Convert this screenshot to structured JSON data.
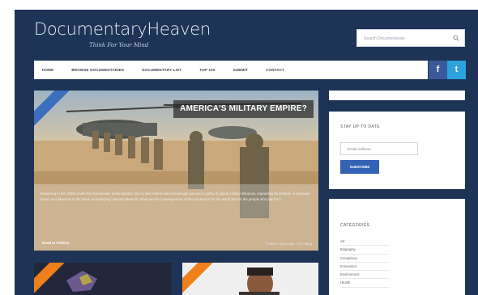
{
  "site": {
    "logo": "DocumentaryHeaven",
    "tagline": "Think For Your Mind",
    "search_placeholder": "Search Documentaries"
  },
  "nav": {
    "items": [
      "HOME",
      "BROWSE DOCUMENTARIES",
      "DOCUMENTARY LIST",
      "TOP 100",
      "SUBMIT",
      "CONTACT"
    ],
    "facebook_icon": "f",
    "twitter_icon": "t"
  },
  "feature": {
    "title": "AMERICA'S MILITARY EMPIRE?",
    "excerpt": "Beginning in the 1950s under the Eisenhower administration, the United States has increasingly pursued a policy of global military influence, expanding its network of overseas bases and alliances in the name of protecting national interests. What are the consequences of this expansion for the world and for the people who pay for it...",
    "read_more": "Read in Politics",
    "meta": "Posted 3 days ago · 8.2 rating"
  },
  "sidebar": {
    "newsletter_title": "STAY UP TO DATE",
    "email_placeholder": "Email Address",
    "subscribe_label": "SUBSCRIBE",
    "categories_title": "CATEGORIES",
    "categories": [
      "Art",
      "Biography",
      "Conspiracy",
      "Economics",
      "Environment",
      "Health"
    ]
  },
  "colors": {
    "background": "#1d3456",
    "accent_blue": "#3462b5",
    "ribbon_orange": "#ef7f1a",
    "facebook": "#3b5998",
    "twitter": "#2aa3df"
  }
}
